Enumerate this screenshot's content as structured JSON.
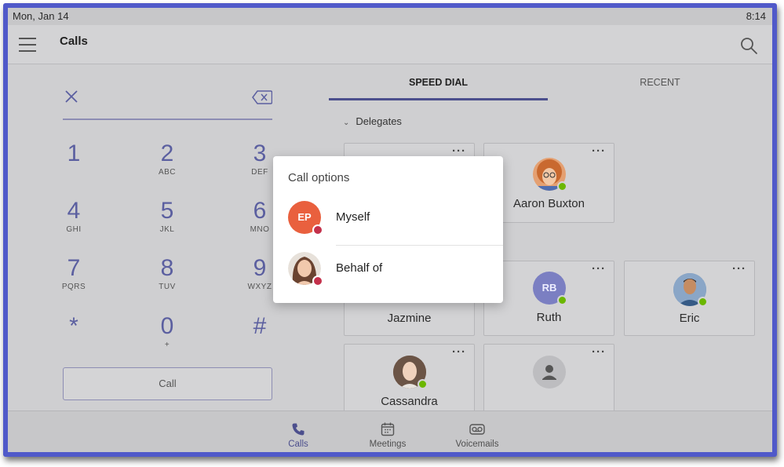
{
  "status_bar": {
    "date": "Mon, Jan 14",
    "time": "8:14"
  },
  "header": {
    "title": "Calls"
  },
  "dialpad": {
    "keys": [
      {
        "digit": "1",
        "letters": ""
      },
      {
        "digit": "2",
        "letters": "ABC"
      },
      {
        "digit": "3",
        "letters": "DEF"
      },
      {
        "digit": "4",
        "letters": "GHI"
      },
      {
        "digit": "5",
        "letters": "JKL"
      },
      {
        "digit": "6",
        "letters": "MNO"
      },
      {
        "digit": "7",
        "letters": "PQRS"
      },
      {
        "digit": "8",
        "letters": "TUV"
      },
      {
        "digit": "9",
        "letters": "WXYZ"
      },
      {
        "digit": "*",
        "letters": ""
      },
      {
        "digit": "0",
        "letters": "+"
      },
      {
        "digit": "#",
        "letters": ""
      }
    ],
    "call_label": "Call"
  },
  "tabs": [
    {
      "label": "SPEED DIAL",
      "active": true
    },
    {
      "label": "RECENT",
      "active": false
    }
  ],
  "speed_dial": {
    "section_label": "Delegates",
    "contacts": [
      {
        "name": "",
        "presence": "available"
      },
      {
        "name": "Aaron Buxton",
        "presence": "available"
      },
      {
        "name": "Jazmine",
        "presence": "available"
      },
      {
        "name": "Ruth",
        "initials": "RB",
        "presence": "available"
      },
      {
        "name": "Eric",
        "presence": "available"
      },
      {
        "name": "Cassandra",
        "presence": "available"
      },
      {
        "name": "",
        "presence": "none"
      }
    ]
  },
  "popup": {
    "title": "Call options",
    "options": [
      {
        "label": "Myself",
        "initials": "EP"
      },
      {
        "label": "Behalf of",
        "initials": ""
      }
    ]
  },
  "bottom_nav": [
    {
      "label": "Calls",
      "active": true
    },
    {
      "label": "Meetings",
      "active": false
    },
    {
      "label": "Voicemails",
      "active": false
    }
  ],
  "colors": {
    "frame_border": "#5059c9",
    "accent": "#4c4f8d",
    "presence_available": "#6bb700",
    "presence_busy": "#c4314b",
    "ep_avatar": "#e9603e",
    "ruth_avatar": "#7b7fc2"
  }
}
